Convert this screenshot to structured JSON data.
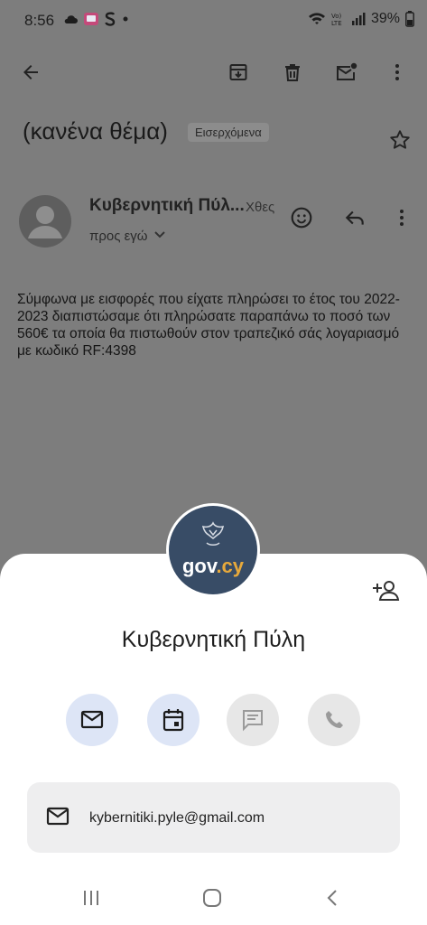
{
  "status_bar": {
    "time": "8:56",
    "icons": [
      "cloud-icon",
      "app-notification-icon",
      "s-app-icon",
      "dot-icon"
    ],
    "right_icons": [
      "wifi-icon",
      "volte-icon",
      "signal-icon"
    ],
    "battery": "39%"
  },
  "app_bar": {
    "icons": [
      "back-arrow-icon",
      "archive-icon",
      "delete-icon",
      "mark-unread-icon",
      "more-vert-icon"
    ]
  },
  "email": {
    "subject": "(κανένα θέμα)",
    "label": "Εισερχόμενα",
    "sender": "Κυβερνητική Πύλ...",
    "time": "Χθες",
    "to": "προς εγώ",
    "body": "Σύμφωνα με εισφορές που είχατε πληρώσει το έτος του 2022-2023 διαπιστώσαμε ότι πληρώσατε παραπάνω το ποσό των 560€ τα οποία θα πιστωθούν στον τραπεζικό σάς λογαριασμό με κωδικό RF:4398"
  },
  "contact_sheet": {
    "avatar_text_main": "gov",
    "avatar_text_accent": ".cy",
    "name": "Κυβερνητική Πύλη",
    "actions": [
      "email",
      "calendar",
      "chat",
      "call"
    ],
    "email_address": "kybernitiki.pyle@gmail.com"
  },
  "colors": {
    "scrim": "#7d7d7d",
    "sheet": "#ffffff",
    "action_active": "#dde5f6",
    "action_disabled": "#e7e7e7",
    "avatar_bg": "#384c66",
    "avatar_accent": "#e7a93b"
  }
}
